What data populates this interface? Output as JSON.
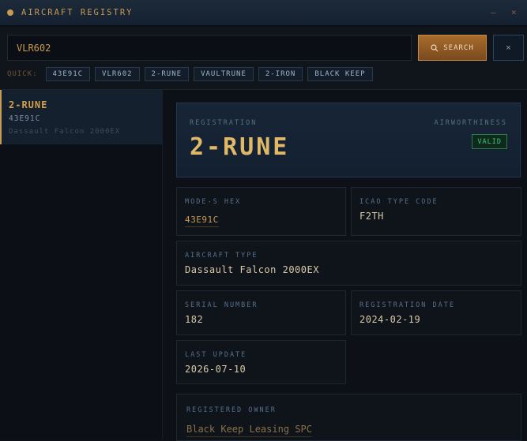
{
  "window": {
    "title": "AIRCRAFT REGISTRY",
    "minimize_glyph": "—",
    "close_glyph": "×"
  },
  "search": {
    "value": "VLR602",
    "button_label": "SEARCH",
    "clear_glyph": "×"
  },
  "quick": {
    "label": "QUICK:",
    "chips": [
      "43E91C",
      "VLR602",
      "2-RUNE",
      "VAULTRUNE",
      "2-IRON",
      "BLACK KEEP"
    ]
  },
  "results": [
    {
      "registration": "2-RUNE",
      "hex": "43E91C",
      "type": "Dassault Falcon 2000EX"
    }
  ],
  "detail": {
    "registration_label": "REGISTRATION",
    "registration": "2-RUNE",
    "airworthiness_label": "AIRWORTHINESS",
    "airworthiness": "VALID",
    "modes_label": "MODE-S HEX",
    "modes": "43E91C",
    "icao_label": "ICAO TYPE CODE",
    "icao": "F2TH",
    "type_label": "AIRCRAFT TYPE",
    "type": "Dassault Falcon 2000EX",
    "serial_label": "SERIAL NUMBER",
    "serial": "182",
    "regdate_label": "REGISTRATION DATE",
    "regdate": "2024-02-19",
    "update_label": "LAST UPDATE",
    "update": "2026-07-10",
    "owner_label": "REGISTERED OWNER",
    "owner": "Black Keep Leasing SPC"
  },
  "colors": {
    "accent": "#c89a52",
    "valid": "#47c27a",
    "background": "#0d1117"
  },
  "icons": {
    "search": "search-icon",
    "close": "close-icon",
    "minimize": "minimize-icon"
  }
}
